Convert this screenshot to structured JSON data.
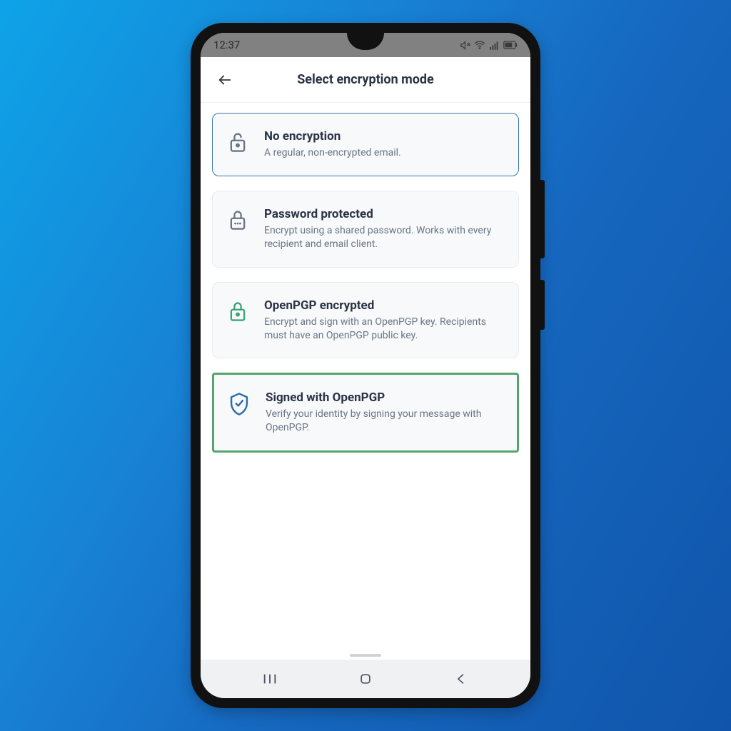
{
  "statusbar": {
    "time": "12:37"
  },
  "header": {
    "title": "Select encryption mode"
  },
  "options": [
    {
      "title": "No encryption",
      "desc": "A regular, non-encrypted email.",
      "icon": "unlock",
      "iconColor": "#6a7585",
      "selected": true,
      "highlight": false
    },
    {
      "title": "Password protected",
      "desc": "Encrypt using a shared password. Works with every recipient and email client.",
      "icon": "lock-dots",
      "iconColor": "#6a7585",
      "selected": false,
      "highlight": false
    },
    {
      "title": "OpenPGP encrypted",
      "desc": "Encrypt and sign with an OpenPGP key. Recipients must have an OpenPGP public key.",
      "icon": "lock",
      "iconColor": "#3aa574",
      "selected": false,
      "highlight": false
    },
    {
      "title": "Signed with OpenPGP",
      "desc": "Verify your identity by signing your message with OpenPGP.",
      "icon": "shield-check",
      "iconColor": "#2e6da8",
      "selected": false,
      "highlight": true
    }
  ]
}
